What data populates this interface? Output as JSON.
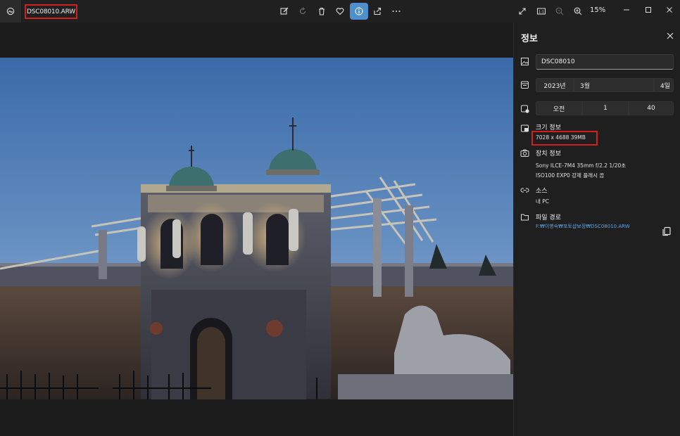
{
  "toolbar": {
    "filename": "DSC08010.ARW",
    "zoom": "15%",
    "icons": [
      "photos-app-icon",
      "edit-icon",
      "rotate-icon",
      "delete-icon",
      "favorite-icon",
      "info-icon",
      "share-icon",
      "more-icon",
      "fullscreen-icon",
      "actual-size-icon",
      "zoom-out-icon",
      "zoom-in-icon",
      "minimize-icon",
      "maximize-icon",
      "close-icon"
    ]
  },
  "panel": {
    "title": "정보",
    "name_value": "DSC08010",
    "date": {
      "year": "2023년",
      "month": "3월",
      "day": "4일"
    },
    "time": {
      "ampm": "오전",
      "hour": "1",
      "minute": "40"
    },
    "size": {
      "label": "크기 정보",
      "value": "7028 x 4688   39MB"
    },
    "device": {
      "label": "장치 정보",
      "line1": "Sony    ILCE-7M4    35mm    f/2.2    1/20초",
      "line2": "ISO100    EXP0    강제 플래시 끔"
    },
    "source": {
      "label": "소스",
      "value": "내 PC"
    },
    "path": {
      "label": "파일 경로",
      "value": "F:₩이병숙₩포토샵보정₩DSC08010.ARW"
    }
  },
  "colors": {
    "accent": "#4f90cc",
    "highlight": "#d21f1f",
    "link": "#5aa5e8"
  }
}
